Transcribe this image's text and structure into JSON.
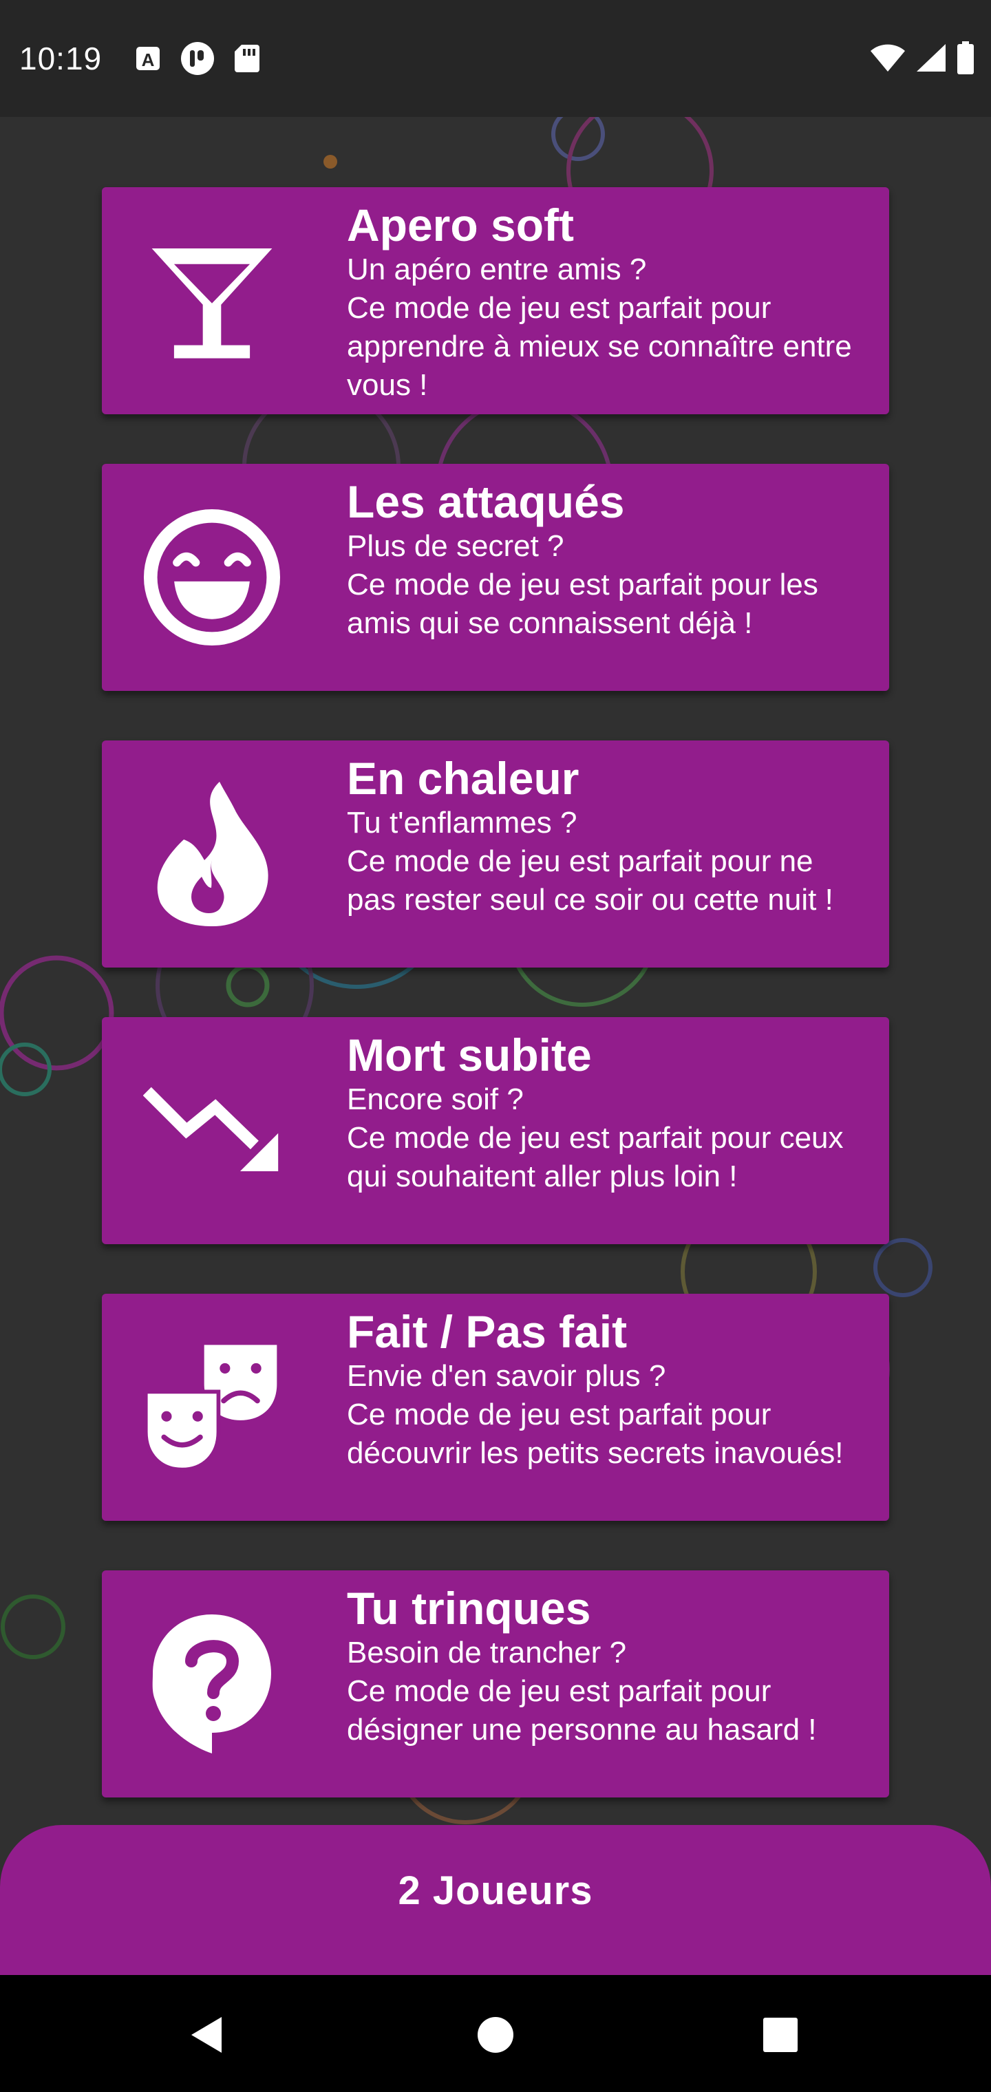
{
  "status_bar": {
    "time": "10:19",
    "left_icons": [
      "font-icon",
      "podcast-icon",
      "sd-card-icon"
    ],
    "right_icons": [
      "wifi-icon",
      "signal-icon",
      "battery-icon"
    ]
  },
  "modes": [
    {
      "title": "Apero soft",
      "subtitle": "Un apéro entre amis ?",
      "description": "Ce mode de jeu est parfait pour apprendre à mieux se connaître entre vous !",
      "icon": "cocktail-icon"
    },
    {
      "title": "Les attaqués",
      "subtitle": "Plus de secret ?",
      "description": "Ce mode de jeu est parfait pour les amis qui se connaissent déjà !",
      "icon": "smiling-face-icon"
    },
    {
      "title": "En chaleur",
      "subtitle": "Tu t'enflammes ?",
      "description": "Ce mode de jeu est parfait pour ne pas rester seul ce soir ou cette nuit !",
      "icon": "flame-icon"
    },
    {
      "title": "Mort subite",
      "subtitle": "Encore soif ?",
      "description": "Ce mode de jeu est parfait pour ceux qui souhaitent aller plus loin !",
      "icon": "trending-down-icon"
    },
    {
      "title": "Fait / Pas fait",
      "subtitle": "Envie d'en savoir plus ?",
      "description": "Ce mode de jeu est parfait pour découvrir les petits secrets inavoués!",
      "icon": "theater-masks-icon"
    },
    {
      "title": "Tu trinques",
      "subtitle": "Besoin de trancher ?",
      "description": "Ce mode de jeu est parfait pour désigner une personne au hasard !",
      "icon": "question-bubble-icon"
    }
  ],
  "players_button": {
    "label": "2 Joueurs"
  },
  "nav": {
    "icons": [
      "back-icon",
      "home-icon",
      "recents-icon"
    ]
  },
  "colors": {
    "background": "#303030",
    "card": "#921d8c",
    "status_bar": "#262626",
    "nav_bar": "#000000",
    "text": "#ffffff"
  }
}
